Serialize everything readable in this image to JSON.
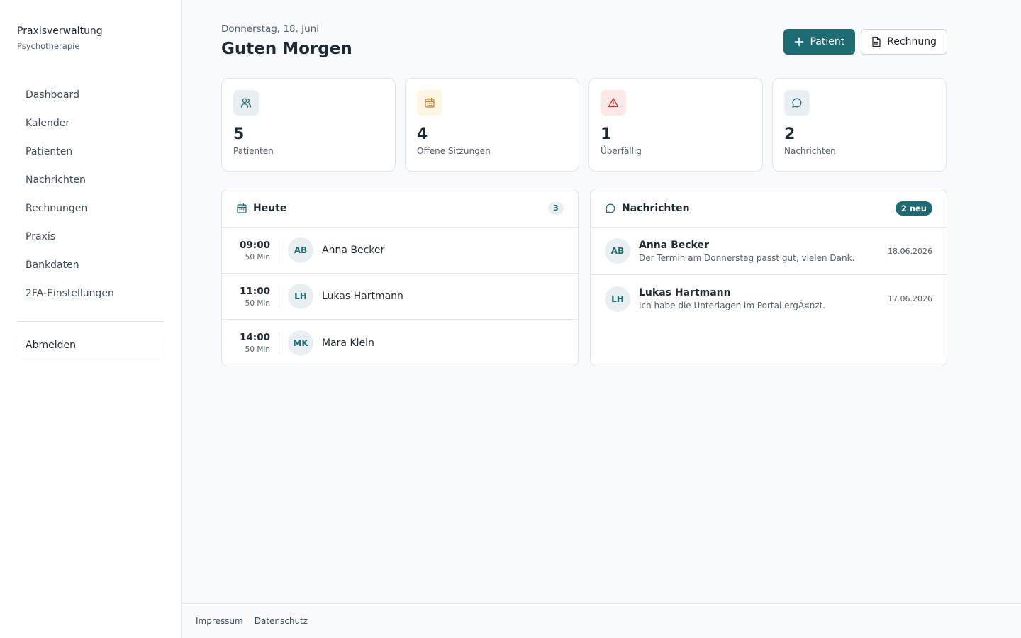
{
  "brand": {
    "title": "Praxisverwaltung",
    "subtitle": "Psychotherapie"
  },
  "nav": {
    "items": [
      {
        "label": "Dashboard"
      },
      {
        "label": "Kalender"
      },
      {
        "label": "Patienten"
      },
      {
        "label": "Nachrichten"
      },
      {
        "label": "Rechnungen"
      },
      {
        "label": "Praxis"
      },
      {
        "label": "Bankdaten"
      },
      {
        "label": "2FA-Einstellungen"
      }
    ],
    "logout": "Abmelden"
  },
  "header": {
    "date": "Donnerstag, 18. Juni",
    "greeting": "Guten Morgen",
    "primary_button": "Patient",
    "secondary_button": "Rechnung"
  },
  "stats": [
    {
      "value": "5",
      "label": "Patienten",
      "icon": "users-icon",
      "bg": "#e8eef1",
      "color": "#1e6b73"
    },
    {
      "value": "4",
      "label": "Offene Sitzungen",
      "icon": "calendar-icon",
      "bg": "#fdf6e3",
      "color": "#c9822b"
    },
    {
      "value": "1",
      "label": "Überfällig",
      "icon": "alert-triangle-icon",
      "bg": "#fde8e8",
      "color": "#d0342c"
    },
    {
      "value": "2",
      "label": "Nachrichten",
      "icon": "message-circle-icon",
      "bg": "#e8eef1",
      "color": "#1e6b73"
    }
  ],
  "today": {
    "title": "Heute",
    "count": "3",
    "appointments": [
      {
        "time": "09:00",
        "duration": "50 Min",
        "initials": "AB",
        "name": "Anna Becker"
      },
      {
        "time": "11:00",
        "duration": "50 Min",
        "initials": "LH",
        "name": "Lukas Hartmann"
      },
      {
        "time": "14:00",
        "duration": "50 Min",
        "initials": "MK",
        "name": "Mara Klein"
      }
    ]
  },
  "messages": {
    "title": "Nachrichten",
    "badge": "2 neu",
    "items": [
      {
        "initials": "AB",
        "name": "Anna Becker",
        "text": "Der Termin am Donnerstag passt gut, vielen Dank.",
        "date": "18.06.2026"
      },
      {
        "initials": "LH",
        "name": "Lukas Hartmann",
        "text": "Ich habe die Unterlagen im Portal ergÃ¤nzt.",
        "date": "17.06.2026"
      }
    ]
  },
  "footer": {
    "impressum": "Impressum",
    "datenschutz": "Datenschutz"
  },
  "colors": {
    "accent": "#1e6b73",
    "background": "#f8fafb"
  }
}
